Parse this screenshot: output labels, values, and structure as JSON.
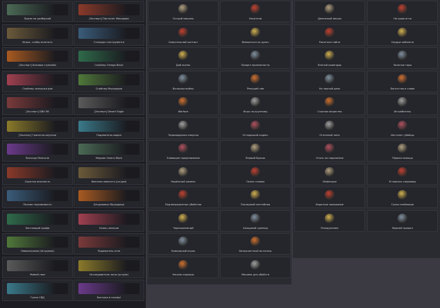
{
  "col1": [
    [
      "Призм на разборкой",
      "[Эксперт] Пистолет Макарова"
    ],
    [
      "Игрок, чтобы взлетать",
      "Стандарт инструмента"
    ],
    [
      "[Эксперт] Базовая стрельба",
      "Снайпер Omega Black"
    ],
    [
      "Снайпер: вспышка ров",
      "Снайпер Мауэрдера"
    ],
    [
      "[Эксперт] DBG 98",
      "[Эксперт] Desert Eagle"
    ],
    [
      "[Эксперт] Гранатка-ипучкое",
      "Подавитель-марин"
    ],
    [
      "Волчица Минсале",
      "Медиан Омега Black"
    ],
    [
      "Скрытая опасность",
      "Военная ловкость (штурм)"
    ],
    [
      "Полная неуязвимость",
      "Штурмовик Мауэрдера"
    ],
    [
      "Настоящий профи",
      "Конец запасов"
    ],
    [
      "Невыносимая (Штурмом)",
      "Подавитель огня"
    ],
    [
      "Живой гвоз",
      "Исследователь зоны (штурм)"
    ],
    [
      "Гроза СВД",
      "Быстрая в голову!"
    ]
  ],
  "col2": [
    [
      "Острый мишень",
      "Носители"
    ],
    [
      "Смертельный контакт",
      "Вмешаться на рукач"
    ],
    [
      "Дай жизнь",
      "Предел прилежности"
    ],
    [
      "Вспышка войны",
      "Ревущий зев"
    ],
    [
      "Warface",
      "Игры по-крупному"
    ],
    [
      "Термоядерная энергия",
      "Огнедыший кодекс"
    ],
    [
      "Зловещее предзнамение",
      "Первый бросок"
    ],
    [
      "Надёжный камень",
      "Около головы"
    ],
    [
      "Подтвержденные убийства",
      "Последний контейнер"
    ],
    [
      "Черношлемный",
      "Холодный сувенир"
    ],
    [
      "Командный игрок",
      "Безжалостный мститель"
    ],
    [
      "Начало карьеры",
      "Машина для убийств"
    ]
  ],
  "col3": [
    [
      "Денежный мешок",
      "На краю огня"
    ],
    [
      "Ракетная тайна",
      "Сердце кобальта"
    ],
    [
      "Взятый командир",
      "Золотые горы"
    ],
    [
      "Не черный день",
      "Богатство и слава"
    ],
    [
      "Стрелок вещество",
      "Истребитель"
    ],
    [
      "Огненный пень",
      "Инстинкт убийцы"
    ],
    [
      "Огонь на поражение",
      "Первая помощь"
    ],
    [
      "Инфекция",
      "В поисках сокровищ"
    ],
    [
      "Короткое замыкание",
      "Гроза снайперов"
    ],
    [
      "Разоружение",
      "Верный прицел"
    ]
  ]
}
